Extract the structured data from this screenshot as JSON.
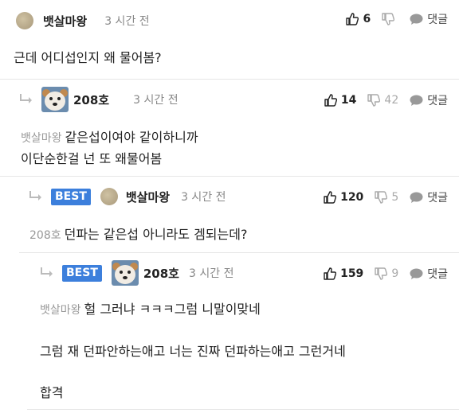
{
  "comments": [
    {
      "nick": "뱃살마왕",
      "time": "3 시간 전",
      "up": "6",
      "down": "",
      "reply": "댓글",
      "lines": [
        "근데 어디섭인지 왜 물어봄?"
      ]
    },
    {
      "nick": "208호",
      "time": "3 시간 전",
      "up": "14",
      "down": "42",
      "reply": "댓글",
      "mention": "뱃살마왕",
      "lines": [
        "같은섭이여야 같이하니까",
        "이단순한걸 넌 또 왜물어봄"
      ]
    },
    {
      "badge": "BEST",
      "nick": "뱃살마왕",
      "time": "3 시간 전",
      "up": "120",
      "down": "5",
      "reply": "댓글",
      "mention": "208호",
      "lines": [
        "던파는 같은섭 아니라도 겜되는데?"
      ]
    },
    {
      "badge": "BEST",
      "nick": "208호",
      "time": "3 시간 전",
      "up": "159",
      "down": "9",
      "reply": "댓글",
      "mention": "뱃살마왕",
      "lines": [
        "헐 그러냐 ㅋㅋㅋ그럼 니말이맞네",
        "그럼 재 던파안하는애고 너는 진짜 던파하는애고 그런거네",
        "합격"
      ]
    }
  ],
  "colors": {
    "best_badge": "#3c7fdc",
    "text": "#222222",
    "muted": "#888888",
    "reply_bg": "#f7f7f7"
  },
  "icons": [
    "thumbs-up-icon",
    "thumbs-down-icon",
    "speech-bubble-icon",
    "reply-arrow-icon"
  ]
}
